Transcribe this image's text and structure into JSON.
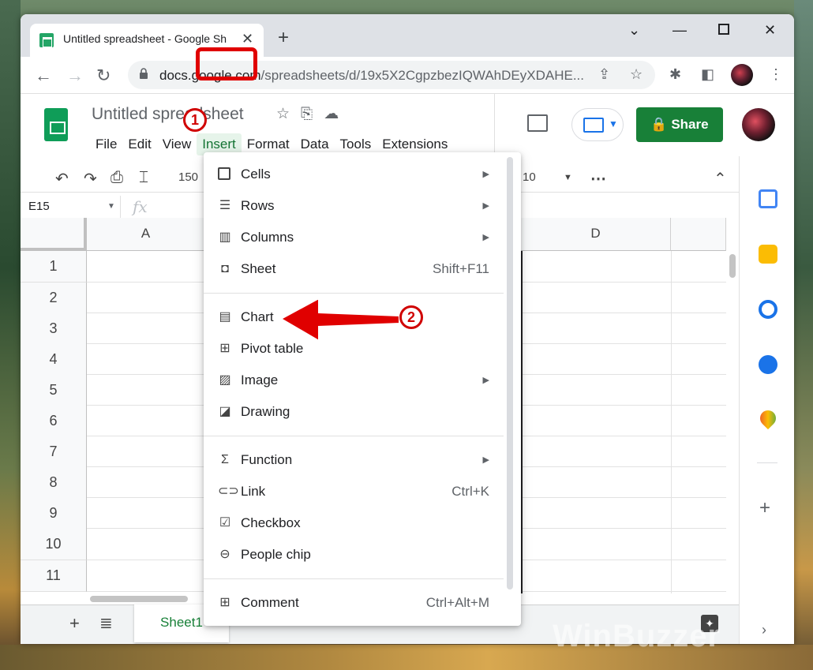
{
  "browser": {
    "tab_title": "Untitled spreadsheet - Google Sh",
    "url_host": "docs.google.com",
    "url_path": "/spreadsheets/d/19x5X2CgpzbezIQWAhDEyXDAHE..."
  },
  "sheets": {
    "doc_title": "Untitled spreadsheet",
    "menus": [
      "File",
      "Edit",
      "View",
      "Insert",
      "Format",
      "Data",
      "Tools",
      "Extensions"
    ],
    "share_label": "Share",
    "zoom": "150",
    "font_size": "10",
    "cell_ref": "E15",
    "fx": "fx",
    "columns": [
      "A",
      "D"
    ],
    "rows": [
      "1",
      "2",
      "3",
      "4",
      "5",
      "6",
      "7",
      "8",
      "9",
      "10",
      "11"
    ],
    "sheet_tab": "Sheet1"
  },
  "insert_menu": {
    "items": [
      {
        "label": "Cells",
        "shortcut": "",
        "submenu": true,
        "icon": "cells-icon"
      },
      {
        "label": "Rows",
        "shortcut": "",
        "submenu": true,
        "icon": "rows-icon"
      },
      {
        "label": "Columns",
        "shortcut": "",
        "submenu": true,
        "icon": "columns-icon"
      },
      {
        "label": "Sheet",
        "shortcut": "Shift+F11",
        "submenu": false,
        "icon": "sheet-icon"
      },
      {
        "label": "Chart",
        "shortcut": "",
        "submenu": false,
        "icon": "chart-icon"
      },
      {
        "label": "Pivot table",
        "shortcut": "",
        "submenu": false,
        "icon": "pivot-table-icon"
      },
      {
        "label": "Image",
        "shortcut": "",
        "submenu": true,
        "icon": "image-icon"
      },
      {
        "label": "Drawing",
        "shortcut": "",
        "submenu": false,
        "icon": "drawing-icon"
      },
      {
        "label": "Function",
        "shortcut": "",
        "submenu": true,
        "icon": "sigma-icon"
      },
      {
        "label": "Link",
        "shortcut": "Ctrl+K",
        "submenu": false,
        "icon": "link-icon"
      },
      {
        "label": "Checkbox",
        "shortcut": "",
        "submenu": false,
        "icon": "checkbox-icon"
      },
      {
        "label": "People chip",
        "shortcut": "",
        "submenu": false,
        "icon": "people-chip-icon"
      },
      {
        "label": "Comment",
        "shortcut": "Ctrl+Alt+M",
        "submenu": false,
        "icon": "comment-icon"
      }
    ]
  },
  "annotations": {
    "step1": "1",
    "step2": "2"
  },
  "watermark": "WinBuzzer",
  "colors": {
    "accent_green": "#188038",
    "annotation_red": "#e00000"
  }
}
